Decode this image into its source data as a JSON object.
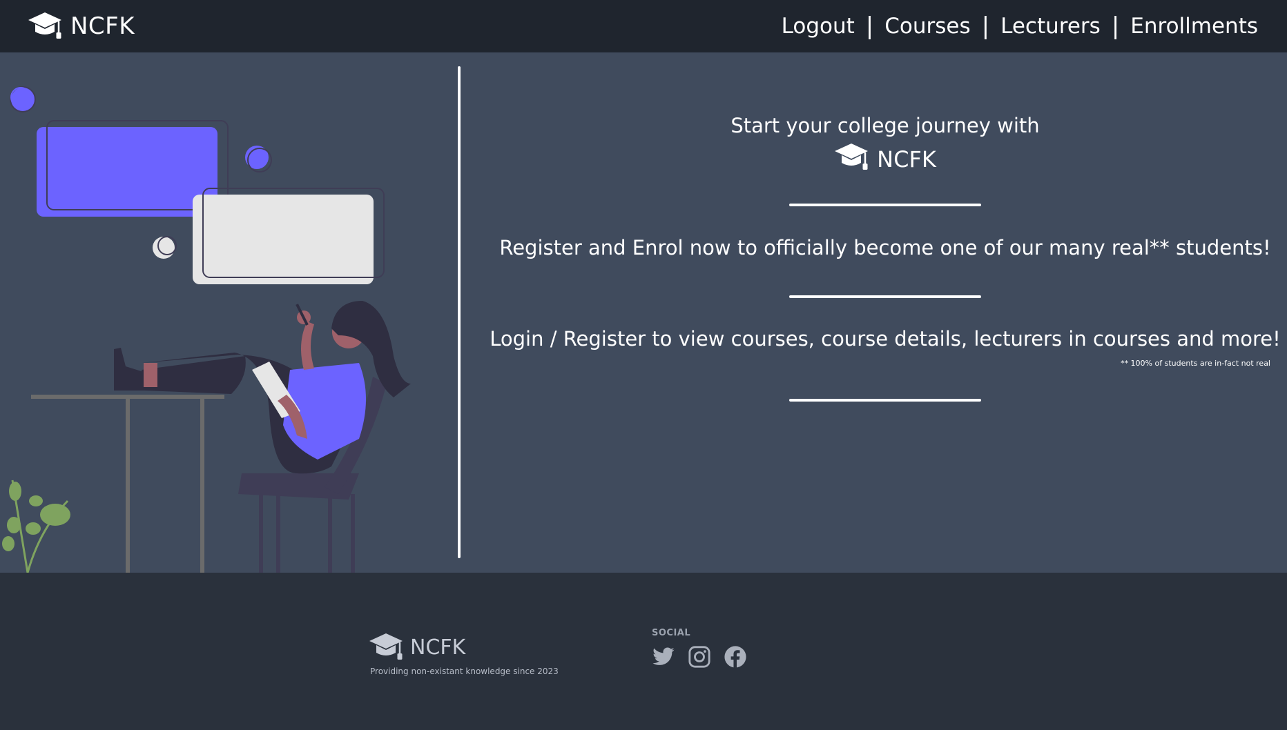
{
  "brand": {
    "name": "NCFK"
  },
  "nav": {
    "links": [
      "Logout",
      "Courses",
      "Lecturers",
      "Enrollments"
    ],
    "separator": "|"
  },
  "main": {
    "intro_line": "Start your college journey with",
    "intro_brand": "NCFK",
    "register_line": "Register and Enrol now to officially become one of our many real** students!",
    "login_line": "Login / Register to view courses, course details, lecturers in courses and more!",
    "footnote": "** 100% of students are in-fact not real"
  },
  "footer": {
    "brand": "NCFK",
    "tagline": "Providing non-existant knowledge since 2023",
    "social_title": "SOCIAL",
    "social_icons": [
      "twitter-icon",
      "instagram-icon",
      "facebook-icon"
    ]
  },
  "colors": {
    "navbar_bg": "#1f252e",
    "main_bg": "#404b5d",
    "footer_bg": "#2a313c",
    "accent": "#6c63ff",
    "text": "#ffffff"
  }
}
